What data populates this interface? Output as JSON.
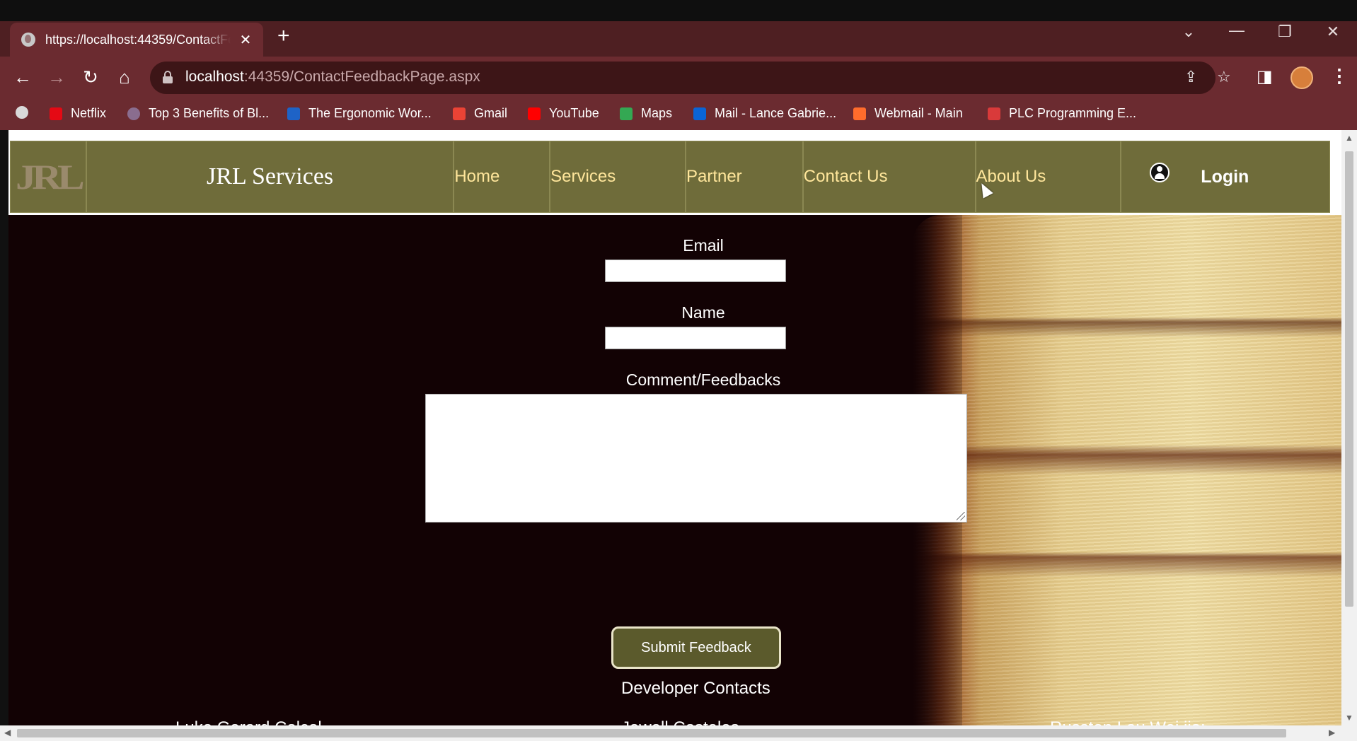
{
  "browser": {
    "tab_title": "https://localhost:44359/ContactFeedbackPage.aspx",
    "tab_close": "✕",
    "new_tab": "+",
    "url_host": "localhost",
    "url_rest": ":44359/ContactFeedbackPage.aspx",
    "window_controls": {
      "dropdown": "⌄",
      "minimize": "—",
      "restore": "❐",
      "close": "✕"
    },
    "nav": {
      "back": "←",
      "forward": "→",
      "reload": "↻",
      "home": "⌂"
    },
    "bookmarks": [
      {
        "label": "",
        "icon": "globe-icon",
        "color": "#d9d9d9"
      },
      {
        "label": "Netflix",
        "icon": "netflix-icon",
        "color": "#e50914"
      },
      {
        "label": "Top 3 Benefits of Bl...",
        "icon": "page-icon",
        "color": "#8a6d8f"
      },
      {
        "label": "The Ergonomic Wor...",
        "icon": "pt-icon",
        "color": "#1e63c7"
      },
      {
        "label": "Gmail",
        "icon": "gmail-icon",
        "color": "#ea4335"
      },
      {
        "label": "YouTube",
        "icon": "youtube-icon",
        "color": "#ff0000"
      },
      {
        "label": "Maps",
        "icon": "maps-icon",
        "color": "#34a853"
      },
      {
        "label": "Mail - Lance Gabrie...",
        "icon": "outlook-icon",
        "color": "#0a64d6"
      },
      {
        "label": "Webmail - Main",
        "icon": "cpanel-icon",
        "color": "#ff6c2c"
      },
      {
        "label": "PLC Programming E...",
        "icon": "plc-icon",
        "color": "#d93a3a"
      }
    ]
  },
  "site": {
    "logo": "JRL",
    "brand": "JRL Services",
    "nav": [
      "Home",
      "Services",
      "Partner",
      "Contact Us",
      "About Us"
    ],
    "login": "Login"
  },
  "form": {
    "email_label": "Email",
    "email_value": "",
    "name_label": "Name",
    "name_value": "",
    "comment_label": "Comment/Feedbacks",
    "comment_value": "",
    "submit_label": "Submit Feedback"
  },
  "contacts": {
    "heading": "Developer Contacts",
    "people": [
      "Luke Gerard Colcol",
      "Jewell Costales",
      "Russton Lau Wei jie:"
    ]
  },
  "colors": {
    "tab_bar": "#4e1f22",
    "toolbar": "#6b2b30",
    "nav_bg": "#6f6c3a",
    "nav_link": "#ffe69b",
    "hero_bg": "#120204",
    "submit_bg": "#5b5a2c"
  }
}
